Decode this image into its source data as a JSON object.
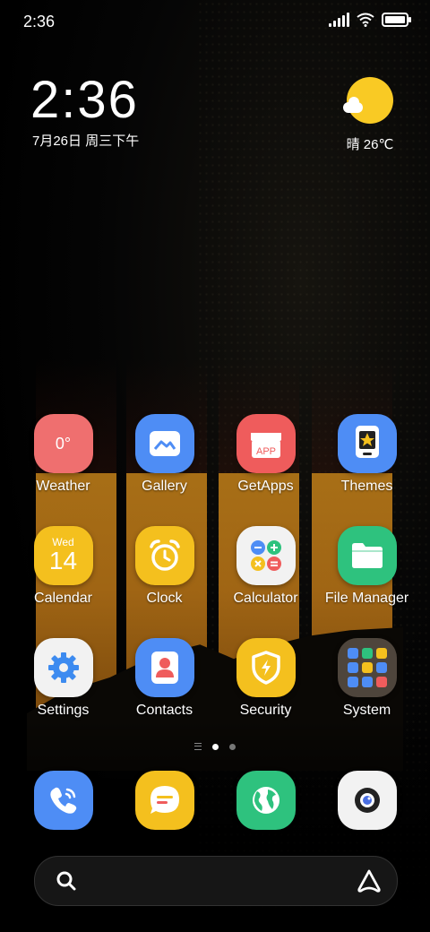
{
  "status_bar": {
    "time": "2:36"
  },
  "clock_widget": {
    "time": "2:36",
    "date": "7月26日 周三下午"
  },
  "weather_widget": {
    "text": "晴 26℃"
  },
  "apps": {
    "weather": {
      "label": "Weather",
      "icon_text": "0°"
    },
    "gallery": {
      "label": "Gallery"
    },
    "getapps": {
      "label": "GetApps",
      "icon_text": "APP"
    },
    "themes": {
      "label": "Themes"
    },
    "calendar": {
      "label": "Calendar",
      "day": "Wed",
      "date": "14"
    },
    "clock": {
      "label": "Clock"
    },
    "calculator": {
      "label": "Calculator"
    },
    "file_manager": {
      "label": "File Manager"
    },
    "settings": {
      "label": "Settings"
    },
    "contacts": {
      "label": "Contacts"
    },
    "security": {
      "label": "Security"
    },
    "system": {
      "label": "System"
    }
  },
  "dock": [
    "phone",
    "messaging",
    "browser",
    "camera"
  ],
  "colors": {
    "weather": "#ef6f6f",
    "blue": "#4e8df5",
    "red": "#ef5c5c",
    "yellow": "#f4c01e",
    "green": "#2ec27e",
    "accent_sun": "#f9ca24"
  }
}
